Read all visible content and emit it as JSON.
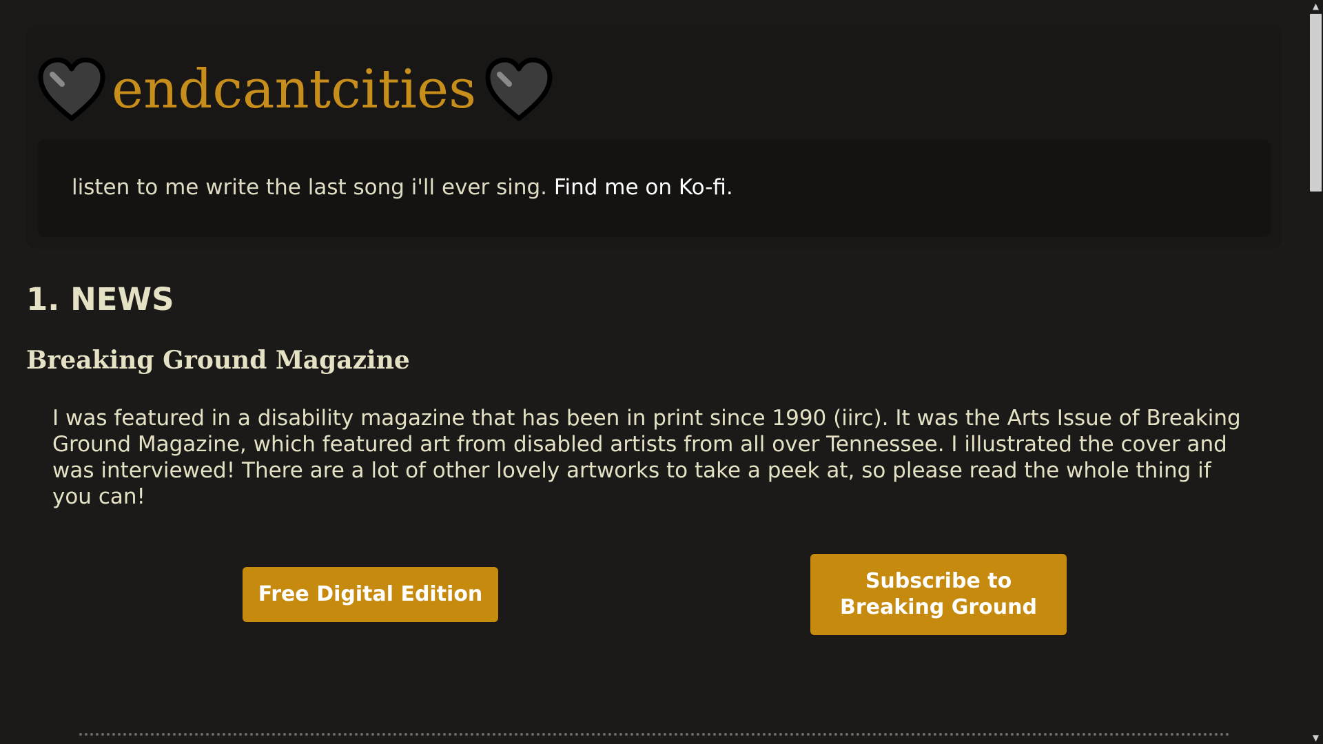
{
  "header": {
    "site_title": "endcantcities",
    "tagline_text": "listen to me write the last song i'll ever sing. ",
    "kofi_link": "Find me on Ko-fi."
  },
  "news": {
    "heading": "1. NEWS",
    "article_title": "Breaking Ground Magazine",
    "article_body": "I was featured in a disability magazine that has been in print since 1990 (iirc). It was the Arts Issue of Breaking Ground Magazine, which featured art from disabled artists from all over Tennessee. I illustrated the cover and was interviewed! There are a lot of other lovely artworks to take a peek at, so please read the whole thing if you can!",
    "free_edition_label": "Free Digital Edition",
    "subscribe_label": "Subscribe to Breaking Ground"
  },
  "icons": {
    "left_heart": "black-heart-icon",
    "right_heart": "black-heart-icon"
  },
  "colors": {
    "background": "#1b1a18",
    "accent": "#c78e1c",
    "button": "#c68a0f",
    "text": "#e4e1c4"
  }
}
